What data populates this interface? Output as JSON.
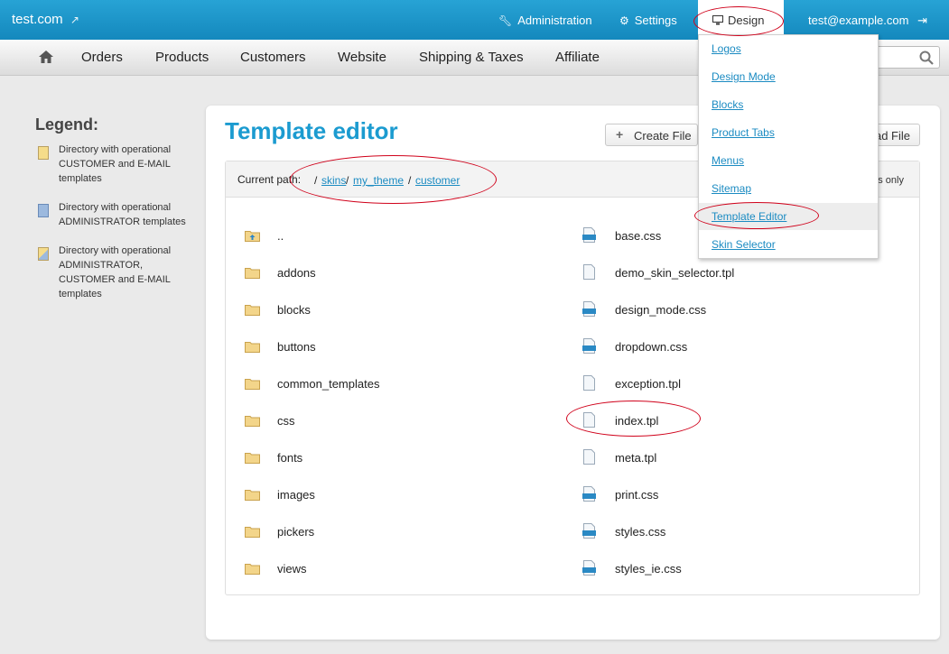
{
  "header": {
    "brand": "test.com",
    "admin_label": "Administration",
    "settings_label": "Settings",
    "design_label": "Design",
    "user_email": "test@example.com"
  },
  "mainnav": {
    "items": [
      "Orders",
      "Products",
      "Customers",
      "Website",
      "Shipping & Taxes",
      "Affiliate"
    ]
  },
  "design_menu": {
    "items": [
      "Logos",
      "Design Mode",
      "Blocks",
      "Product Tabs",
      "Menus",
      "Sitemap",
      "Template Editor",
      "Skin Selector"
    ],
    "active": "Template Editor"
  },
  "legend": {
    "title": "Legend:",
    "items": [
      {
        "text": "Directory with operational CUSTOMER and E-MAIL templates"
      },
      {
        "text": "Directory with operational ADMINISTRATOR templates"
      },
      {
        "text": "Directory with operational ADMINISTRATOR, CUSTOMER and E-MAIL templates"
      }
    ]
  },
  "page": {
    "title": "Template editor",
    "create_file": "Create File",
    "upload_file_partial": "ad File",
    "path_label": "Current path:",
    "path_root": "/",
    "crumbs": [
      "skins",
      "my_theme",
      "customer"
    ],
    "path_right_partial": "s only"
  },
  "directories": [
    "..",
    "addons",
    "blocks",
    "buttons",
    "common_templates",
    "css",
    "fonts",
    "images",
    "pickers",
    "views"
  ],
  "files": [
    {
      "name": "base.css",
      "kind": "css"
    },
    {
      "name": "demo_skin_selector.tpl",
      "kind": "tpl"
    },
    {
      "name": "design_mode.css",
      "kind": "css"
    },
    {
      "name": "dropdown.css",
      "kind": "css"
    },
    {
      "name": "exception.tpl",
      "kind": "tpl"
    },
    {
      "name": "index.tpl",
      "kind": "tpl"
    },
    {
      "name": "meta.tpl",
      "kind": "tpl"
    },
    {
      "name": "print.css",
      "kind": "css"
    },
    {
      "name": "styles.css",
      "kind": "css"
    },
    {
      "name": "styles_ie.css",
      "kind": "css"
    }
  ],
  "colors": {
    "topbar": "#1a95c9",
    "title": "#1b9bd0",
    "link": "#1b8bc2",
    "annotation": "#d0021b"
  }
}
